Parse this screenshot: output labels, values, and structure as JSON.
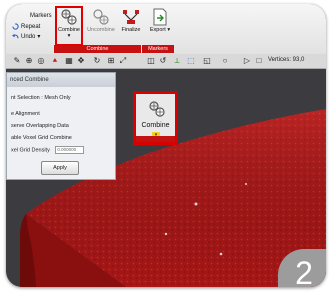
{
  "ribbon": {
    "small_commands": [
      {
        "label": "Markers",
        "icon": "markers-icon"
      },
      {
        "label": "Repeat",
        "icon": "repeat-icon"
      },
      {
        "label": "Undo",
        "icon": "undo-icon"
      }
    ],
    "undo_arrow": "▾",
    "buttons": [
      {
        "label": "Combine",
        "icon": "combine-icon",
        "enabled": true
      },
      {
        "label": "Uncombine",
        "icon": "uncombine-icon",
        "enabled": false
      },
      {
        "label": "Finalize",
        "icon": "finalize-icon",
        "enabled": true
      },
      {
        "label": "Export",
        "icon": "export-icon",
        "enabled": true
      }
    ],
    "combine_arrow": "▾",
    "export_arrow": "▾",
    "groups": [
      "Combine",
      "Markers"
    ]
  },
  "toolbar": {
    "vertices_label": "Vertices: 93,0"
  },
  "panel": {
    "title": "nced Combine",
    "point_selection": "nt Selection :  Mesh Only",
    "options": [
      "e Alignment",
      "serve Overlapping Data",
      "able Voxel Grid Combine"
    ],
    "grid_density_label": "xel Grid Density",
    "grid_density_value": "0.000000",
    "apply_label": "Apply"
  },
  "callout": {
    "label": "Combine",
    "arrow": "▾"
  },
  "step_badge": "2",
  "colors": {
    "accent_red": "#c71010",
    "mesh_red": "#b01818",
    "background": "#3c3c40"
  }
}
